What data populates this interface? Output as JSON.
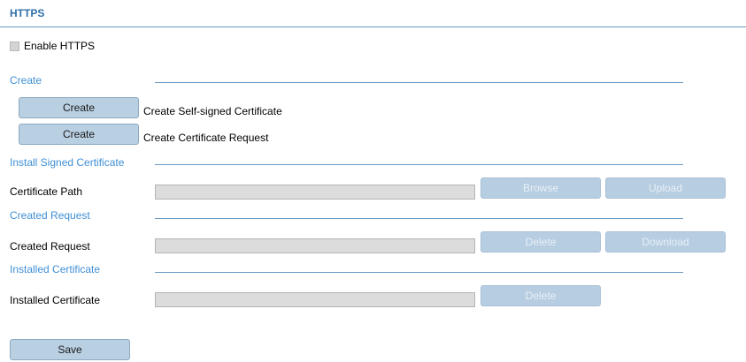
{
  "page": {
    "title": "HTTPS"
  },
  "enable": {
    "label": "Enable HTTPS",
    "checked": false
  },
  "create_section": {
    "title": "Create",
    "rows": [
      {
        "button": "Create",
        "description": "Create Self-signed Certificate"
      },
      {
        "button": "Create",
        "description": "Create Certificate Request"
      }
    ]
  },
  "install_section": {
    "title": "Install Signed Certificate",
    "field_label": "Certificate Path",
    "field_value": "",
    "browse": "Browse",
    "upload": "Upload"
  },
  "request_section": {
    "title": "Created Request",
    "field_label": "Created Request",
    "field_value": "",
    "delete": "Delete",
    "download": "Download"
  },
  "installed_section": {
    "title": "Installed Certificate",
    "field_label": "Installed Certificate",
    "field_value": "",
    "delete": "Delete"
  },
  "footer": {
    "save": "Save"
  },
  "colors": {
    "accent": "#2f6fa8",
    "section_label": "#3f8fd6",
    "button_bg": "#b9cfe2",
    "field_bg": "#dcdcdc"
  }
}
